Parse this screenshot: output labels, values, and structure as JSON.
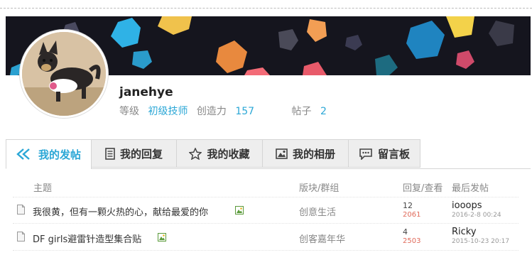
{
  "profile": {
    "username": "janehye",
    "level_label": "等级",
    "level_value": "初级技师",
    "creativity_label": "创造力",
    "creativity_value": "157",
    "posts_label": "帖子",
    "posts_value": "2"
  },
  "tabs": [
    {
      "label": "我的发帖",
      "icon": "reply-arrow-icon",
      "active": true
    },
    {
      "label": "我的回复",
      "icon": "document-icon",
      "active": false
    },
    {
      "label": "我的收藏",
      "icon": "star-icon",
      "active": false
    },
    {
      "label": "我的相册",
      "icon": "image-icon",
      "active": false
    },
    {
      "label": "留言板",
      "icon": "message-icon",
      "active": false
    }
  ],
  "table": {
    "headers": [
      "主题",
      "版块/群组",
      "回复/查看",
      "最后发帖"
    ],
    "rows": [
      {
        "subject": "我很黄，但有一颗火热的心，献给最爱的你",
        "forum": "创意生活",
        "replies": "12",
        "views": "2061",
        "last_user": "iooops",
        "last_time": "2016-2-8 00:24"
      },
      {
        "subject": "DF girls避雷针造型集合贴",
        "forum": "创客嘉年华",
        "replies": "4",
        "views": "2503",
        "last_user": "Ricky",
        "last_time": "2015-10-23 20:17"
      }
    ]
  },
  "colors": {
    "accent": "#2ba7d6",
    "banner_bg": "#15151e"
  }
}
